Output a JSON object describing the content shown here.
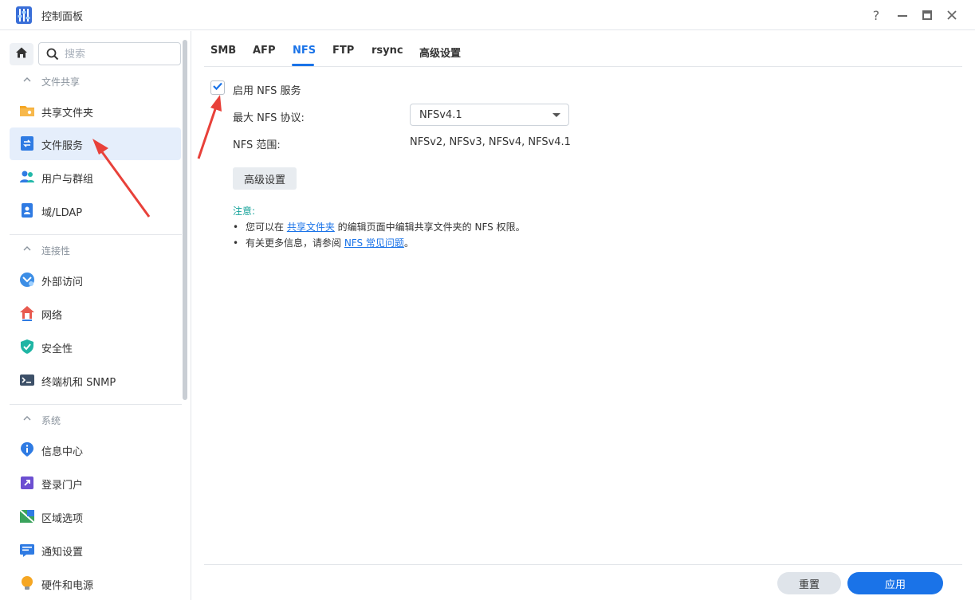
{
  "window": {
    "title": "控制面板",
    "help_icon": "question-icon",
    "minimize_icon": "minimize-icon",
    "maximize_icon": "maximize-icon",
    "close_icon": "close-icon"
  },
  "sidebar": {
    "search_placeholder": "搜索",
    "sections": [
      {
        "title": "文件共享",
        "items": [
          {
            "label": "共享文件夹",
            "icon": "folder-icon"
          },
          {
            "label": "文件服务",
            "icon": "file-service-icon",
            "active": true
          },
          {
            "label": "用户与群组",
            "icon": "users-icon"
          },
          {
            "label": "域/LDAP",
            "icon": "ldap-icon"
          }
        ]
      },
      {
        "title": "连接性",
        "items": [
          {
            "label": "外部访问",
            "icon": "external-access-icon"
          },
          {
            "label": "网络",
            "icon": "network-icon"
          },
          {
            "label": "安全性",
            "icon": "shield-icon"
          },
          {
            "label": "终端机和 SNMP",
            "icon": "terminal-icon"
          }
        ]
      },
      {
        "title": "系统",
        "items": [
          {
            "label": "信息中心",
            "icon": "info-icon"
          },
          {
            "label": "登录门户",
            "icon": "login-portal-icon"
          },
          {
            "label": "区域选项",
            "icon": "region-icon"
          },
          {
            "label": "通知设置",
            "icon": "notification-icon"
          },
          {
            "label": "硬件和电源",
            "icon": "bulb-icon"
          }
        ]
      }
    ]
  },
  "tabs": [
    "SMB",
    "AFP",
    "NFS",
    "FTP",
    "rsync",
    "高级设置"
  ],
  "active_tab": "NFS",
  "nfs": {
    "enable_label": "启用 NFS 服务",
    "enabled": true,
    "max_protocol_label": "最大 NFS 协议:",
    "max_protocol_value": "NFSv4.1",
    "range_label": "NFS 范围:",
    "range_value": "NFSv2, NFSv3, NFSv4, NFSv4.1",
    "advanced_button": "高级设置"
  },
  "notes": {
    "title": "注意:",
    "line1_pre": "您可以在 ",
    "line1_link": "共享文件夹",
    "line1_post": " 的编辑页面中编辑共享文件夹的 NFS 权限。",
    "line2_pre": "有关更多信息，请参阅 ",
    "line2_link": "NFS 常见问题",
    "line2_post": "。"
  },
  "footer": {
    "reset_label": "重置",
    "apply_label": "应用"
  },
  "colors": {
    "accent": "#1a73e8",
    "note": "#16a39a",
    "annotation_arrow": "#e8413a"
  }
}
